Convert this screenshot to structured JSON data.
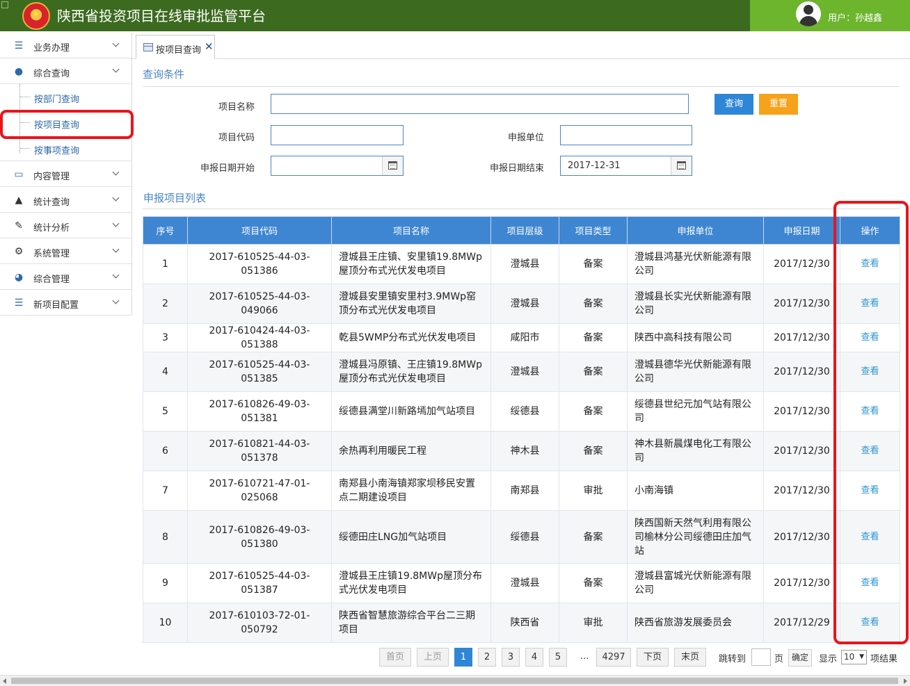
{
  "header": {
    "app_title": "陕西省投资项目在线审批监管平台",
    "user_label": "用户：孙越鑫"
  },
  "sidebar": {
    "items": [
      {
        "label": "业务办理",
        "icon": "list-icon"
      },
      {
        "label": "综合查询",
        "icon": "user-icon"
      },
      {
        "label": "内容管理",
        "icon": "monitor-icon"
      },
      {
        "label": "统计查询",
        "icon": "bell-icon"
      },
      {
        "label": "统计分析",
        "icon": "edit-icon"
      },
      {
        "label": "系统管理",
        "icon": "gear-icon"
      },
      {
        "label": "综合管理",
        "icon": "dashboard-icon"
      },
      {
        "label": "新项目配置",
        "icon": "list-icon"
      }
    ],
    "subitems": [
      {
        "label": "按部门查询"
      },
      {
        "label": "按项目查询"
      },
      {
        "label": "按事项查询"
      }
    ]
  },
  "tabs": [
    {
      "label": "按项目查询"
    }
  ],
  "query": {
    "section_title": "查询条件",
    "project_name_label": "项目名称",
    "project_name_value": "",
    "project_code_label": "项目代码",
    "project_code_value": "",
    "applicant_label": "申报单位",
    "applicant_value": "",
    "date_start_label": "申报日期开始",
    "date_start_value": "",
    "date_end_label": "申报日期结束",
    "date_end_value": "2017-12-31",
    "query_button": "查询",
    "reset_button": "重置"
  },
  "list": {
    "section_title": "申报项目列表",
    "columns": [
      "序号",
      "项目代码",
      "项目名称",
      "项目层级",
      "项目类型",
      "申报单位",
      "申报日期",
      "操作"
    ],
    "rows": [
      {
        "no": "1",
        "code": "2017-610525-44-03-051386",
        "name": "澄城县王庄镇、安里镇19.8MWp屋顶分布式光伏发电项目",
        "level": "澄城县",
        "type": "备案",
        "unit": "澄城县鸿基光伏新能源有限公司",
        "date": "2017/12/30",
        "op": "查看"
      },
      {
        "no": "2",
        "code": "2017-610525-44-03-049066",
        "name": "澄城县安里镇安里村3.9MWp窑顶分布式光伏发电项目",
        "level": "澄城县",
        "type": "备案",
        "unit": "澄城县长实光伏新能源有限公司",
        "date": "2017/12/30",
        "op": "查看"
      },
      {
        "no": "3",
        "code": "2017-610424-44-03-051388",
        "name": "乾县5WMP分布式光伏发电项目",
        "level": "咸阳市",
        "type": "备案",
        "unit": "陕西中高科技有限公司",
        "date": "2017/12/30",
        "op": "查看"
      },
      {
        "no": "4",
        "code": "2017-610525-44-03-051385",
        "name": "澄城县冯原镇、王庄镇19.8MWp屋顶分布式光伏发电项目",
        "level": "澄城县",
        "type": "备案",
        "unit": "澄城县德华光伏新能源有限公司",
        "date": "2017/12/30",
        "op": "查看"
      },
      {
        "no": "5",
        "code": "2017-610826-49-03-051381",
        "name": "绥德县满堂川新路墕加气站项目",
        "level": "绥德县",
        "type": "备案",
        "unit": "绥德县世纪元加气站有限公司",
        "date": "2017/12/30",
        "op": "查看"
      },
      {
        "no": "6",
        "code": "2017-610821-44-03-051378",
        "name": "余热再利用暖民工程",
        "level": "神木县",
        "type": "备案",
        "unit": "神木县新晨煤电化工有限公司",
        "date": "2017/12/30",
        "op": "查看"
      },
      {
        "no": "7",
        "code": "2017-610721-47-01-025068",
        "name": "南郑县小南海镇郑家坝移民安置点二期建设项目",
        "level": "南郑县",
        "type": "审批",
        "unit": "小南海镇",
        "date": "2017/12/30",
        "op": "查看"
      },
      {
        "no": "8",
        "code": "2017-610826-49-03-051380",
        "name": "绥德田庄LNG加气站项目",
        "level": "绥德县",
        "type": "备案",
        "unit": "陕西国新天然气利用有限公司榆林分公司绥德田庄加气站",
        "date": "2017/12/30",
        "op": "查看"
      },
      {
        "no": "9",
        "code": "2017-610525-44-03-051387",
        "name": "澄城县王庄镇19.8MWp屋顶分布式光伏发电项目",
        "level": "澄城县",
        "type": "备案",
        "unit": "澄城县富城光伏新能源有限公司",
        "date": "2017/12/30",
        "op": "查看"
      },
      {
        "no": "10",
        "code": "2017-610103-72-01-050792",
        "name": "陕西省智慧旅游综合平台二三期项目",
        "level": "陕西省",
        "type": "审批",
        "unit": "陕西省旅游发展委员会",
        "date": "2017/12/29",
        "op": "查看"
      }
    ]
  },
  "pagination": {
    "first": "首页",
    "prev": "上页",
    "pages": [
      "1",
      "2",
      "3",
      "4",
      "5"
    ],
    "ellipsis": "...",
    "last_page": "4297",
    "next": "下页",
    "last": "末页",
    "goto_label": "跳转到",
    "page_unit": "页",
    "confirm": "确定",
    "show_label": "显示",
    "page_size": "10",
    "result_label": "项结果"
  }
}
